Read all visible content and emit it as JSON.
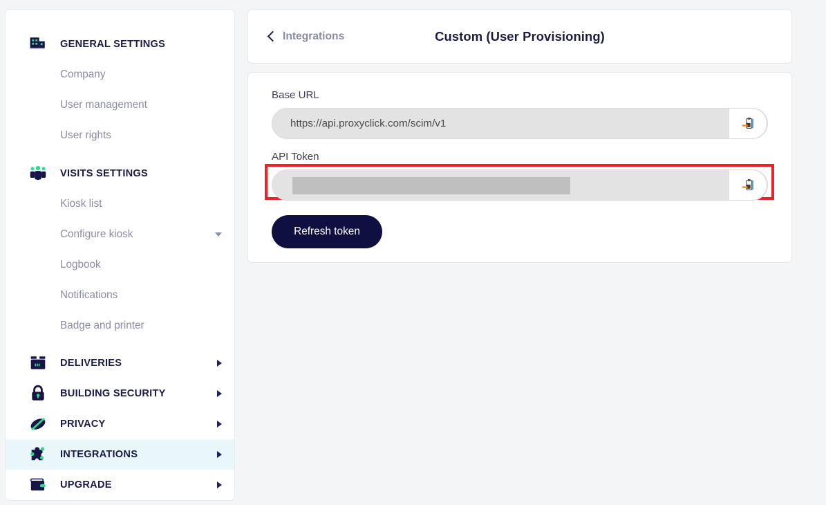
{
  "sidebar": {
    "sections": [
      {
        "type": "section",
        "id": "general-settings",
        "label": "GENERAL SETTINGS",
        "icon": "building-icon",
        "expandable": false,
        "active": false
      },
      {
        "type": "sub",
        "id": "company",
        "label": "Company",
        "caret": "none"
      },
      {
        "type": "sub",
        "id": "user-management",
        "label": "User management",
        "caret": "none"
      },
      {
        "type": "sub",
        "id": "user-rights",
        "label": "User rights",
        "caret": "none"
      },
      {
        "type": "section",
        "id": "visits-settings",
        "label": "VISITS SETTINGS",
        "icon": "visitors-group-icon",
        "expandable": false,
        "active": false
      },
      {
        "type": "sub",
        "id": "kiosk-list",
        "label": "Kiosk list",
        "caret": "none"
      },
      {
        "type": "sub",
        "id": "configure-kiosk",
        "label": "Configure kiosk",
        "caret": "down"
      },
      {
        "type": "sub",
        "id": "logbook",
        "label": "Logbook",
        "caret": "none"
      },
      {
        "type": "sub",
        "id": "notifications",
        "label": "Notifications",
        "caret": "none"
      },
      {
        "type": "sub",
        "id": "badge-and-printer",
        "label": "Badge and printer",
        "caret": "none"
      },
      {
        "type": "section",
        "id": "deliveries",
        "label": "DELIVERIES",
        "icon": "package-icon",
        "expandable": true,
        "active": false
      },
      {
        "type": "section",
        "id": "building-security",
        "label": "BUILDING SECURITY",
        "icon": "lock-icon",
        "expandable": true,
        "active": false
      },
      {
        "type": "section",
        "id": "privacy",
        "label": "PRIVACY",
        "icon": "eye-slash-icon",
        "expandable": true,
        "active": false
      },
      {
        "type": "section",
        "id": "integrations",
        "label": "INTEGRATIONS",
        "icon": "puzzle-piece-icon",
        "expandable": true,
        "active": true
      },
      {
        "type": "section",
        "id": "upgrade",
        "label": "UPGRADE",
        "icon": "wallet-icon",
        "expandable": true,
        "active": false
      }
    ]
  },
  "header": {
    "back_label": "Integrations",
    "back_icon": "chevron-left-icon",
    "title": "Custom (User Provisioning)"
  },
  "form": {
    "base_url": {
      "label": "Base URL",
      "value": "https://api.proxyclick.com/scim/v1",
      "copy_icon": "clipboard-paste-icon"
    },
    "api_token": {
      "label": "API Token",
      "value": "",
      "masked": true,
      "copy_icon": "clipboard-paste-icon",
      "highlighted": true
    },
    "refresh_button": "Refresh token"
  },
  "colors": {
    "brand_navy": "#100f42",
    "accent_green": "#2bdd8b",
    "active_row": "#e9f7fb",
    "highlight_red": "#e8232a",
    "muted_text": "#8b8da3",
    "page_background": "#f4f5f6"
  }
}
